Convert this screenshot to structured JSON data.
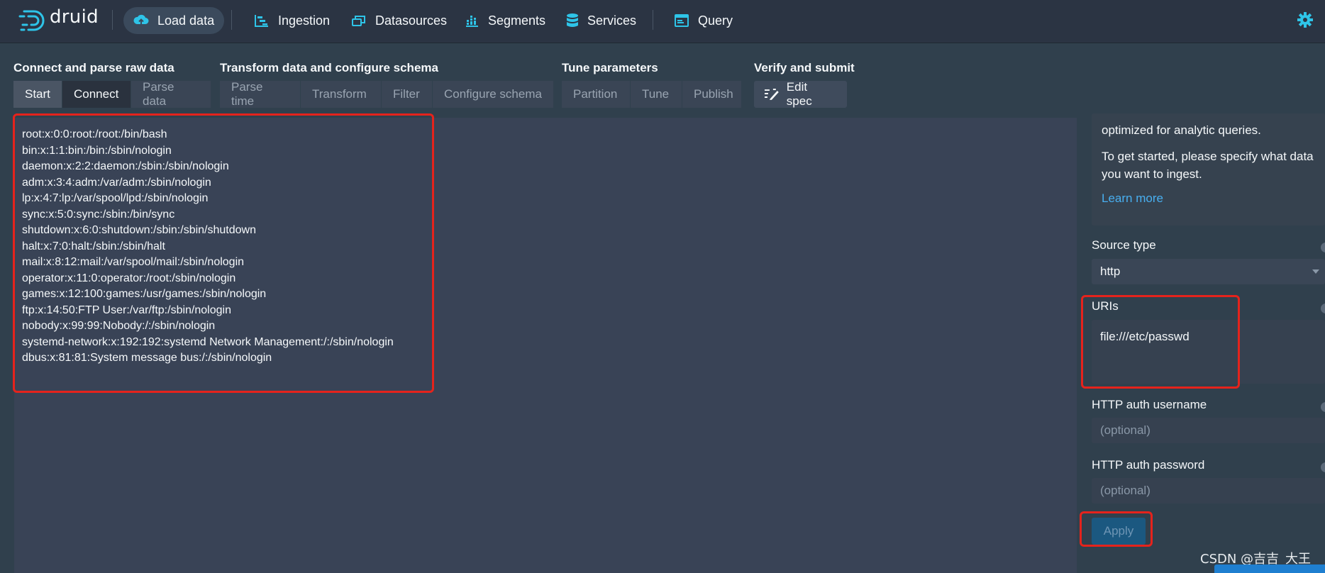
{
  "app": {
    "logo_text": "druid"
  },
  "nav": {
    "items": [
      {
        "label": "Load data",
        "icon": "cloud-upload-icon",
        "active": true
      },
      {
        "label": "Ingestion",
        "icon": "gantt-chart-icon"
      },
      {
        "label": "Datasources",
        "icon": "multi-select-icon"
      },
      {
        "label": "Segments",
        "icon": "stacked-chart-icon"
      },
      {
        "label": "Services",
        "icon": "database-icon"
      },
      {
        "label": "Query",
        "icon": "application-icon"
      }
    ],
    "settings_icon": "cog-icon"
  },
  "steps": {
    "groups": [
      {
        "title": "Connect and parse raw data",
        "tabs": [
          "Start",
          "Connect",
          "Parse data"
        ]
      },
      {
        "title": "Transform data and configure schema",
        "tabs": [
          "Parse time",
          "Transform",
          "Filter",
          "Configure schema"
        ]
      },
      {
        "title": "Tune parameters",
        "tabs": [
          "Partition",
          "Tune",
          "Publish"
        ]
      },
      {
        "title": "Verify and submit",
        "tabs": [
          "Edit spec"
        ]
      }
    ],
    "current": "Connect"
  },
  "raw_data": {
    "lines": [
      "root:x:0:0:root:/root:/bin/bash",
      "bin:x:1:1:bin:/bin:/sbin/nologin",
      "daemon:x:2:2:daemon:/sbin:/sbin/nologin",
      "adm:x:3:4:adm:/var/adm:/sbin/nologin",
      "lp:x:4:7:lp:/var/spool/lpd:/sbin/nologin",
      "sync:x:5:0:sync:/sbin:/bin/sync",
      "shutdown:x:6:0:shutdown:/sbin:/sbin/shutdown",
      "halt:x:7:0:halt:/sbin:/sbin/halt",
      "mail:x:8:12:mail:/var/spool/mail:/sbin/nologin",
      "operator:x:11:0:operator:/root:/sbin/nologin",
      "games:x:12:100:games:/usr/games:/sbin/nologin",
      "ftp:x:14:50:FTP User:/var/ftp:/sbin/nologin",
      "nobody:x:99:99:Nobody:/:/sbin/nologin",
      "systemd-network:x:192:192:systemd Network Management:/:/sbin/nologin",
      "dbus:x:81:81:System message bus:/:/sbin/nologin"
    ]
  },
  "panel": {
    "info_line_1": "optimized for analytic queries.",
    "info_line_2": "To get started, please specify what data you want to ingest.",
    "learn_more": "Learn more",
    "source_type_label": "Source type",
    "source_type_value": "http",
    "uris_label": "URIs",
    "uris_value": "file:///etc/passwd",
    "auth_user_label": "HTTP auth username",
    "auth_user_placeholder": "(optional)",
    "auth_pass_label": "HTTP auth password",
    "auth_pass_placeholder": "(optional)",
    "apply_label": "Apply"
  },
  "watermark": "CSDN @吉吉_大王",
  "colors": {
    "accent": "#48aff0",
    "highlight": "#e5231c",
    "nav_bg": "#2b3443"
  }
}
